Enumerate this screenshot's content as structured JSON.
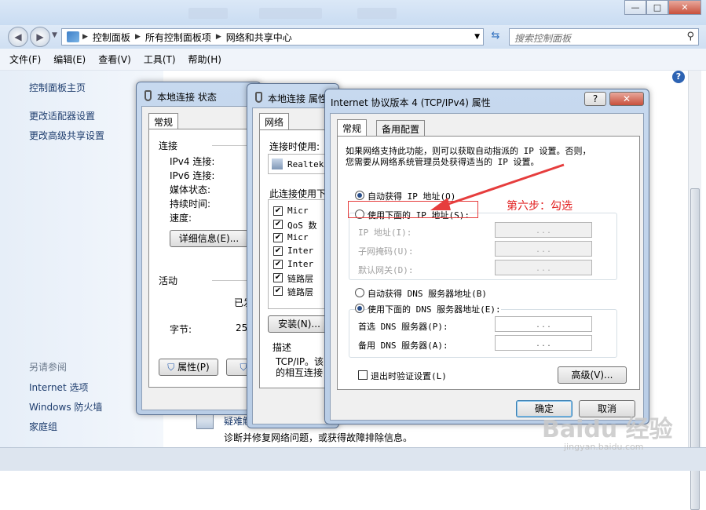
{
  "explorer": {
    "breadcrumb": [
      "控制面板",
      "所有控制面板项",
      "网络和共享中心"
    ],
    "search_placeholder": "搜索控制面板",
    "menu": [
      "文件(F)",
      "编辑(E)",
      "查看(V)",
      "工具(T)",
      "帮助(H)"
    ],
    "window_controls": {
      "minimize": "—",
      "maximize": "□",
      "close": "✕"
    },
    "left_links": [
      "控制面板主页",
      "更改适配器设置",
      "更改高级共享设置"
    ],
    "see_also_title": "另请参阅",
    "see_also_links": [
      "Internet 选项",
      "Windows 防火墙",
      "家庭组"
    ],
    "troubleshoot_link": "疑难解答",
    "troubleshoot_text": "诊断并修复网络问题，或获得故障排除信息。"
  },
  "status_dialog": {
    "title": "本地连接 状态",
    "tab": "常规",
    "connection_section": "连接",
    "rows": [
      "IPv4 连接:",
      "IPv6 连接:",
      "媒体状态:",
      "持续时间:",
      "速度:"
    ],
    "details_button": "详细信息(E)...",
    "activity_section": "活动",
    "sent_partial": "已发",
    "bytes_label": "字节:",
    "bytes_value": "25",
    "properties_button": "属性(P)"
  },
  "props_dialog": {
    "title": "本地连接 属性",
    "tab": "网络",
    "connect_using_label": "连接时使用:",
    "adapter_name": "Realtek",
    "items_label": "此连接使用下",
    "items": [
      "Micr",
      "QoS 数",
      "Micr",
      "Inter",
      "Inter",
      "链路层",
      "链路层"
    ],
    "install_button": "安装(N)...",
    "desc_section": "描述",
    "desc_text_1": "TCP/IP。该",
    "desc_text_2": "的相互连接"
  },
  "ipv4_dialog": {
    "title": "Internet 协议版本 4 (TCP/IPv4) 属性",
    "help_button": "?",
    "close_button": "✕",
    "tabs": [
      "常规",
      "备用配置"
    ],
    "intro_1": "如果网络支持此功能，则可以获取自动指派的 IP 设置。否则，",
    "intro_2": "您需要从网络系统管理员处获得适当的 IP 设置。",
    "auto_ip": "自动获得 IP 地址(O)",
    "manual_ip": "使用下面的 IP 地址(S):",
    "ip_label": "IP 地址(I):",
    "mask_label": "子网掩码(U):",
    "gateway_label": "默认网关(D):",
    "auto_dns": "自动获得 DNS 服务器地址(B)",
    "manual_dns": "使用下面的 DNS 服务器地址(E):",
    "pref_dns": "首选 DNS 服务器(P):",
    "alt_dns": "备用 DNS 服务器(A):",
    "ip_dots": ". . .",
    "validate_label": "退出时验证设置(L)",
    "advanced_button": "高级(V)...",
    "ok_button": "确定",
    "cancel_button": "取消"
  },
  "annotation": "第六步：勾选",
  "watermark": "Baidu 经验",
  "watermark_url": "jingyan.baidu.com",
  "colors": {
    "annotation": "#e22222",
    "link": "#1e3d6e",
    "title_bg": "#c7d9ef"
  }
}
